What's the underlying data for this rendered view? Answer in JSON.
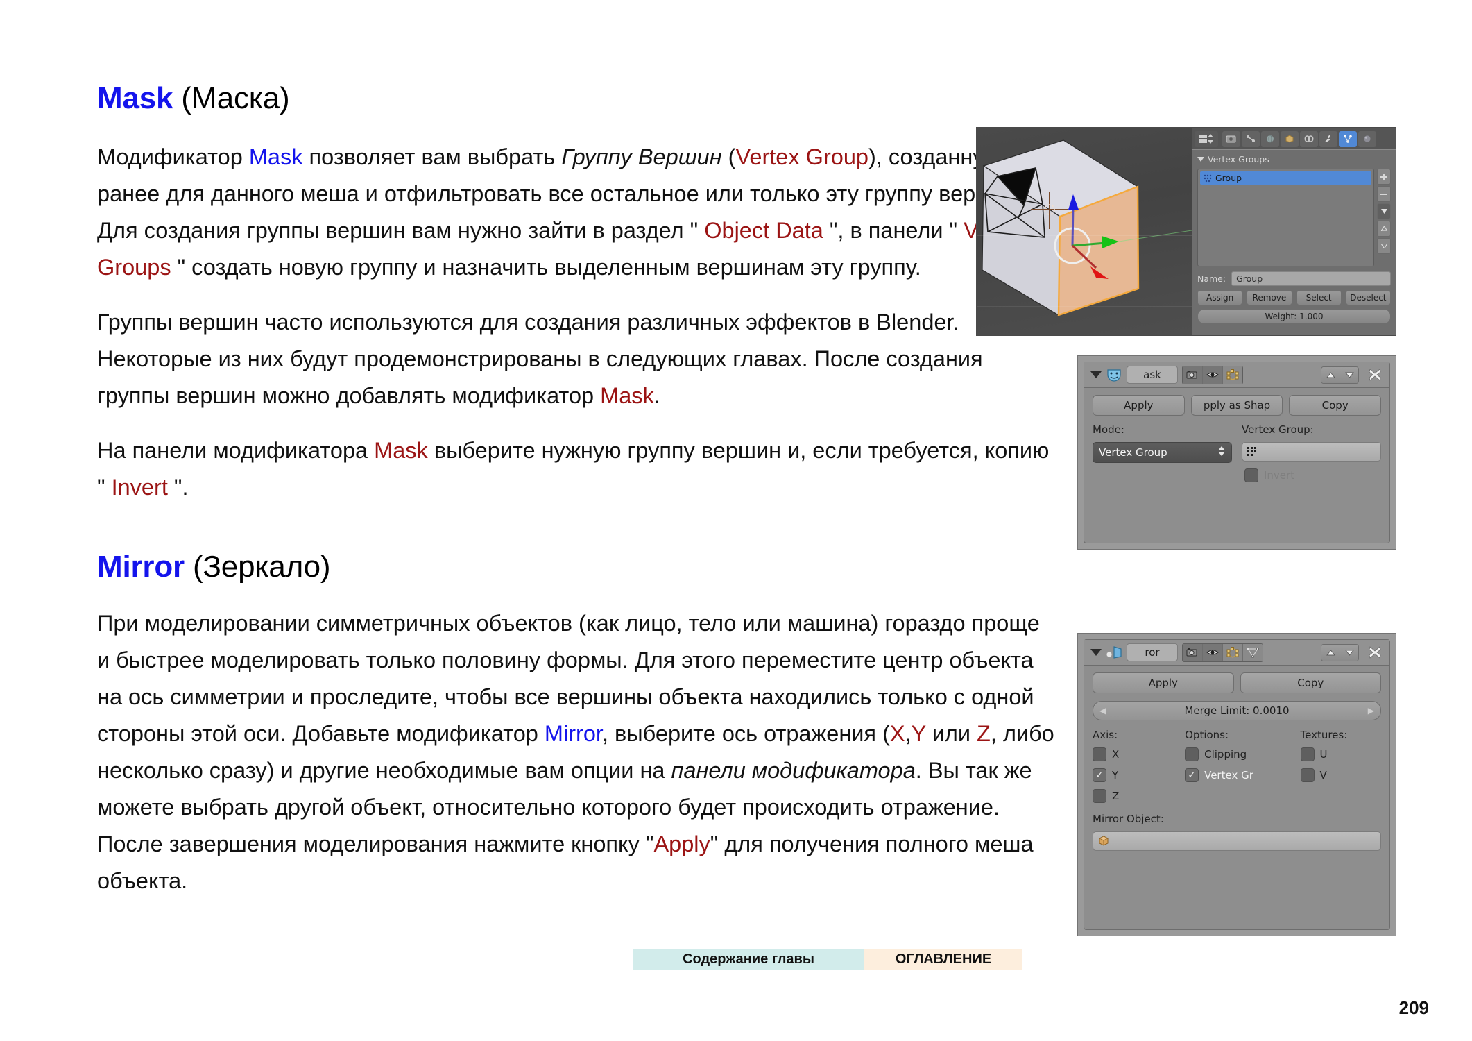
{
  "page": {
    "number": "209"
  },
  "sections": [
    {
      "id": "mask",
      "heading_en": "Mask",
      "heading_ru": "(Маска)",
      "paragraphs": [
        {
          "parts": [
            {
              "t": "Модификатор ",
              "s": "plain"
            },
            {
              "t": "Mask",
              "s": "blue"
            },
            {
              "t": " позволяет вам выбрать ",
              "s": "plain"
            },
            {
              "t": "Группу Вершин",
              "s": "italic"
            },
            {
              "t": " (",
              "s": "plain"
            },
            {
              "t": "Vertex Group",
              "s": "red"
            },
            {
              "t": "), созданную ранее для данного меша и отфильтровать все остальное или только эту группу вершин. Для создания группы вершин вам нужно зайти в раздел \" ",
              "s": "plain"
            },
            {
              "t": "Object Data",
              "s": "red"
            },
            {
              "t": " \", в панели \" ",
              "s": "plain"
            },
            {
              "t": "Vertex Groups",
              "s": "red"
            },
            {
              "t": " \" создать новую группу и назначить выделенным вершинам эту группу.",
              "s": "plain"
            }
          ]
        },
        {
          "parts": [
            {
              "t": "Группы вершин часто используются для создания различных эффектов в Blender. Некоторые из них будут продемонстрированы в следующих главах. После создания группы вершин можно добавлять модификатор ",
              "s": "plain"
            },
            {
              "t": "Mask",
              "s": "red"
            },
            {
              "t": ".",
              "s": "plain"
            }
          ]
        },
        {
          "parts": [
            {
              "t": "На панели модификатора ",
              "s": "plain"
            },
            {
              "t": "Mask",
              "s": "red"
            },
            {
              "t": " выберите нужную группу вершин и, если требуется, копию \" ",
              "s": "plain"
            },
            {
              "t": "Invert",
              "s": "red"
            },
            {
              "t": " \".",
              "s": "plain"
            }
          ]
        }
      ]
    },
    {
      "id": "mirror",
      "heading_en": "Mirror",
      "heading_ru": "(Зеркало)",
      "paragraphs": [
        {
          "parts": [
            {
              "t": "При моделировании симметричных объектов (как лицо, тело или машина) гораздо проще и быстрее моделировать только половину формы. Для этого переместите центр объекта на ось симметрии и проследите, чтобы все вершины объекта находились только с одной стороны этой оси. Добавьте модификатор ",
              "s": "plain"
            },
            {
              "t": "Mirror",
              "s": "blue"
            },
            {
              "t": ", выберите ось отражения (",
              "s": "plain"
            },
            {
              "t": "X",
              "s": "red"
            },
            {
              "t": ",",
              "s": "plain"
            },
            {
              "t": "Y",
              "s": "red"
            },
            {
              "t": " или ",
              "s": "plain"
            },
            {
              "t": "Z",
              "s": "red"
            },
            {
              "t": ", либо несколько сразу) и другие необходимые вам опции на ",
              "s": "plain"
            },
            {
              "t": "панели модификатора",
              "s": "italic"
            },
            {
              "t": ". Вы так же можете выбрать другой объект, относительно которого будет происходить отражение. После завершения моделирования нажмите кнопку \"",
              "s": "plain"
            },
            {
              "t": "Apply",
              "s": "red"
            },
            {
              "t": "\" для получения полного меша объекта.",
              "s": "plain"
            }
          ]
        }
      ]
    }
  ],
  "figures": {
    "vertex_groups_panel": {
      "panel_title": "Vertex Groups",
      "list_items": [
        "Group"
      ],
      "name_label": "Name:",
      "name_value": "Group",
      "buttons": [
        "Assign",
        "Remove",
        "Select",
        "Deselect"
      ],
      "weight_label": "Weight: 1.000",
      "side_buttons": [
        "+",
        "–",
        "▼",
        "▲",
        "▼"
      ],
      "tabs": [
        {
          "name": "render-tab",
          "glyph": "▤",
          "active": false
        },
        {
          "name": "scene-tab",
          "glyph": "⚙",
          "active": false
        },
        {
          "name": "world-tab",
          "glyph": "☼",
          "active": false
        },
        {
          "name": "object-tab",
          "glyph": "▣",
          "active": false
        },
        {
          "name": "constraints-tab",
          "glyph": "⚭",
          "active": false
        },
        {
          "name": "modifiers-tab",
          "glyph": "⚒",
          "active": false
        },
        {
          "name": "object-data-tab",
          "glyph": "▽",
          "active": true
        },
        {
          "name": "material-tab",
          "glyph": "●",
          "active": false
        }
      ]
    },
    "mask_modifier": {
      "name_value": "ask",
      "buttons": [
        "Apply",
        "pply as Shap",
        "Copy"
      ],
      "mode_label": "Mode:",
      "mode_value": "Vertex Group",
      "vertex_group_label": "Vertex Group:",
      "vertex_group_value": "",
      "invert_label": "Invert",
      "invert_checked": false,
      "toggles": [
        "render-toggle",
        "viewport-toggle",
        "editmode-toggle"
      ]
    },
    "mirror_modifier": {
      "name_value": "ror",
      "buttons": [
        "Apply",
        "Copy"
      ],
      "merge_limit_label": "Merge Limit: 0.0010",
      "axis_label": "Axis:",
      "options_label": "Options:",
      "textures_label": "Textures:",
      "axis": [
        {
          "label": "X",
          "checked": false
        },
        {
          "label": "Y",
          "checked": true
        },
        {
          "label": "Z",
          "checked": false
        }
      ],
      "options": [
        {
          "label": "Clipping",
          "checked": false
        },
        {
          "label": "Vertex Gr",
          "checked": true
        }
      ],
      "textures": [
        {
          "label": "U",
          "checked": false
        },
        {
          "label": "V",
          "checked": false
        }
      ],
      "mirror_object_label": "Mirror Object:",
      "mirror_object_value": "",
      "toggles": [
        "render-toggle",
        "viewport-toggle",
        "editmode-toggle",
        "cage-toggle"
      ]
    }
  },
  "footer": {
    "chapter_button": "Содержание главы",
    "toc_button": "ОГЛАВЛЕНИЕ"
  },
  "colors": {
    "heading_blue": "#1414ec",
    "keyword_red": "#9b1414",
    "footer_chapter_bg": "#d2eceb",
    "footer_toc_bg": "#fdeedd",
    "blender_select_blue": "#5189d6"
  }
}
